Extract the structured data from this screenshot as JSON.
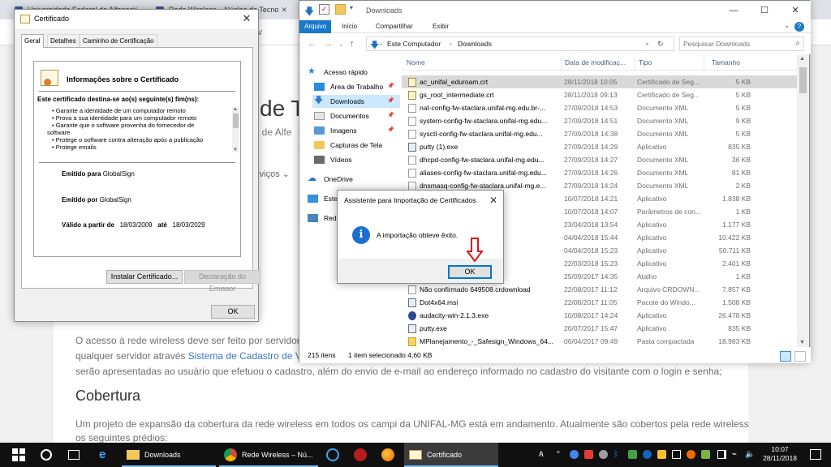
{
  "browser": {
    "tabs": [
      {
        "title": "Universidade Federal de Alfenas"
      },
      {
        "title": "Rede Wireless – Núcleo de Tecno"
      }
    ],
    "url_fragment": "s/",
    "page": {
      "big_title_fragment": "de T",
      "subtitle_fragment": "al de Alfe",
      "nav_fragment": "rviços ⌄",
      "para1_line1": "O acesso à rede wireless deve ser feito por servidore",
      "para1_line2_pre": "qualquer servidor através ",
      "para1_line2_link": "Sistema de Cadastro de Vi",
      "para1_line3": "serão apresentadas ao usuário que efetuou o cadastro, além do envio de e-mail ao endereço informado no cadastro do visitante com o login e senha;",
      "heading": "Cobertura",
      "para2_line1": "Um projeto de expansão da cobertura da rede wireless em todos os campi da UNIFAL-MG está em andamento. Atualmente são cobertos pela rede wireless",
      "para2_line2": "os seguintes prédios:"
    }
  },
  "certificate_window": {
    "title": "Certificado",
    "tabs": [
      "Geral",
      "Detalhes",
      "Caminho de Certificação"
    ],
    "heading": "Informações sobre o Certificado",
    "purpose_title": "Este certificado destina-se ao(s) seguinte(s) fim(ns):",
    "purposes": [
      "• Garante a identidade de um computador remoto",
      "• Prova a sua identidade para um computador remoto",
      "• Garante que o software provenha do fornecedor de",
      "software",
      "• Protege o software contra alteração após a publicação",
      "• Protege emails"
    ],
    "issued_to_label": "Emitido para",
    "issued_to_value": "GlobalSign",
    "issued_by_label": "Emitido por",
    "issued_by_value": "GlobalSign",
    "valid_from_label": "Válido a partir de",
    "valid_from_value": "18/03/2009",
    "valid_to_label": "até",
    "valid_to_value": "18/03/2029",
    "install_button": "Instalar Certificado...",
    "issuer_statement_button": "Declaração do Emissor",
    "ok_button": "OK"
  },
  "explorer": {
    "title": "Downloads",
    "ribbon_tabs": [
      "Arquivo",
      "Início",
      "Compartilhar",
      "Exibir"
    ],
    "breadcrumb": [
      "Este Computador",
      "Downloads"
    ],
    "search_placeholder": "Pesquisar Downloads",
    "nav_items": [
      {
        "label": "Acesso rápido",
        "icon": "star-icon"
      },
      {
        "label": "Área de Trabalho",
        "icon": "desktop-icon"
      },
      {
        "label": "Downloads",
        "icon": "download-icon"
      },
      {
        "label": "Documentos",
        "icon": "documents-icon"
      },
      {
        "label": "Imagens",
        "icon": "pictures-icon"
      },
      {
        "label": "Capturas de Tela",
        "icon": "folder-icon"
      },
      {
        "label": "Vídeos",
        "icon": "videos-icon"
      },
      {
        "label": "OneDrive",
        "icon": "onedrive-icon"
      },
      {
        "label": "Este",
        "icon": "computer-icon"
      },
      {
        "label": "Rede",
        "icon": "network-icon"
      }
    ],
    "columns": [
      "Nome",
      "Data de modificaç...",
      "Tipo",
      "Tamanho"
    ],
    "files": [
      {
        "name": "ac_unifal_eduroam.crt",
        "date": "28/11/2018 10:05",
        "type": "Certificado de Seg...",
        "size": "5 KB",
        "kind": "crt"
      },
      {
        "name": "gs_root_intermediate.crt",
        "date": "28/11/2018 09:13",
        "type": "Certificado de Seg...",
        "size": "5 KB",
        "kind": "crt"
      },
      {
        "name": "nat-config-fw-staclara.unifal-mg.edu.br-...",
        "date": "27/09/2018 14:53",
        "type": "Documento XML",
        "size": "5 KB",
        "kind": "xml"
      },
      {
        "name": "system-config-fw-staclara.unifal-mg.edu...",
        "date": "27/09/2018 14:51",
        "type": "Documento XML",
        "size": "9 KB",
        "kind": "xml"
      },
      {
        "name": "sysctl-config-fw-staclara.unifal-mg.edu...",
        "date": "27/09/2018 14:38",
        "type": "Documento XML",
        "size": "5 KB",
        "kind": "xml"
      },
      {
        "name": "putty (1).exe",
        "date": "27/09/2018 14:29",
        "type": "Aplicativo",
        "size": "835 KB",
        "kind": "exe"
      },
      {
        "name": "dhcpd-config-fw-staclara.unifal-mg.edu...",
        "date": "27/09/2018 14:27",
        "type": "Documento XML",
        "size": "36 KB",
        "kind": "xml"
      },
      {
        "name": "aliases-config-fw-staclara.unifal-mg.edu...",
        "date": "27/09/2018 14:26",
        "type": "Documento XML",
        "size": "81 KB",
        "kind": "xml"
      },
      {
        "name": "dnsmasq-config-fw-staclara.unifal-mg.e...",
        "date": "27/09/2018 14:24",
        "type": "Documento XML",
        "size": "2 KB",
        "kind": "xml"
      },
      {
        "name": "",
        "date": "10/07/2018 14:21",
        "type": "Aplicativo",
        "size": "1.838 KB",
        "kind": "exe"
      },
      {
        "name": "",
        "date": "10/07/2018 14:07",
        "type": "Parâmetros de con...",
        "size": "1 KB",
        "kind": "xml"
      },
      {
        "name": "exe",
        "date": "23/04/2018 13:54",
        "type": "Aplicativo",
        "size": "1.177 KB",
        "kind": "exe"
      },
      {
        "name": "",
        "date": "04/04/2018 15:44",
        "type": "Aplicativo",
        "size": "10.422 KB",
        "kind": "exe"
      },
      {
        "name": "",
        "date": "04/04/2018 15:23",
        "type": "Aplicativo",
        "size": "50.711 KB",
        "kind": "exe"
      },
      {
        "name": "e",
        "date": "22/03/2018 15:23",
        "type": "Aplicativo",
        "size": "2.401 KB",
        "kind": "exe"
      },
      {
        "name": "",
        "date": "25/09/2017 14:35",
        "type": "Atalho",
        "size": "1 KB",
        "kind": "lnk"
      },
      {
        "name": "Não confirmado 649508.crdownload",
        "date": "22/08/2017 11:12",
        "type": "Arquivo CRDOWN...",
        "size": "7.857 KB",
        "kind": "xml"
      },
      {
        "name": "Dot4x64.msi",
        "date": "22/08/2017 11:05",
        "type": "Pacote do Windo...",
        "size": "1.508 KB",
        "kind": "exe"
      },
      {
        "name": "audacity-win-2.1.3.exe",
        "date": "10/08/2017 14:24",
        "type": "Aplicativo",
        "size": "26.478 KB",
        "kind": "aud"
      },
      {
        "name": "putty.exe",
        "date": "20/07/2017 15:47",
        "type": "Aplicativo",
        "size": "835 KB",
        "kind": "exe"
      },
      {
        "name": "MPlanejamento_-_Safesign_Windows_64...",
        "date": "06/04/2017 09:49",
        "type": "Pasta compactada",
        "size": "18.983 KB",
        "kind": "zip"
      }
    ],
    "status_count": "215 itens",
    "status_selected": "1 item selecionado  4,60 KB"
  },
  "dialog": {
    "title": "Assistente para Importação de Certificados",
    "message": "A importação obteve êxito.",
    "ok_button": "OK",
    "icon": "info-icon"
  },
  "taskbar": {
    "items": [
      {
        "label": "Downloads"
      },
      {
        "label": "Rede Wireless – Nú..."
      },
      {
        "label": "Certificado"
      }
    ],
    "time": "10:07",
    "date": "28/11/2018"
  },
  "colors": {
    "accent": "#0078d7",
    "ribbon_file": "#1979ca",
    "selection": "#d9d9d9",
    "nav_selection": "#cce8ff",
    "link": "#3877c5",
    "arrow": "#e0161b"
  }
}
